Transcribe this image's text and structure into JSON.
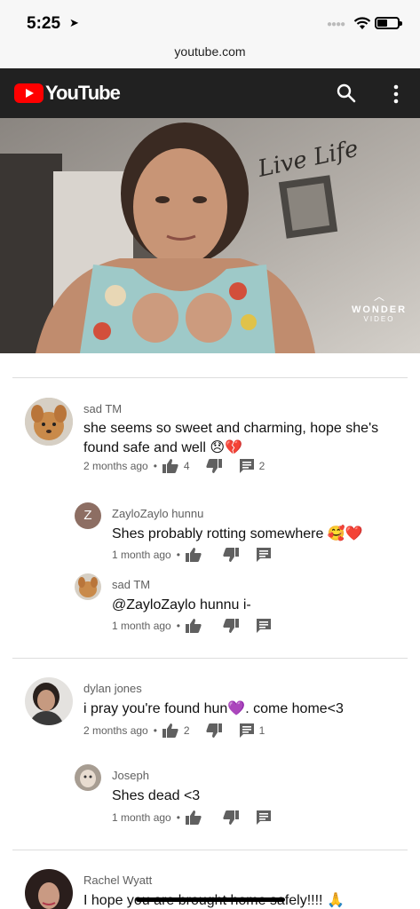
{
  "status": {
    "time": "5:25",
    "location_icon": "location-arrow-icon"
  },
  "browser": {
    "url": "youtube.com"
  },
  "header": {
    "logo_text": "YouTube"
  },
  "video": {
    "wall_text": "Live Life",
    "watermark_line1": "WONDER",
    "watermark_line2": "VIDEO"
  },
  "comments": [
    {
      "author": "sad TM",
      "text": "she seems so sweet and charming, hope she's found safe and well 😞💔",
      "age": "2 months ago",
      "likes": "4",
      "replies": "2",
      "replies_list": [
        {
          "author": "ZayloZaylo hunnu",
          "avatar_letter": "Z",
          "text": "Shes probably rotting somewhere 🥰❤️",
          "age": "1 month ago"
        },
        {
          "author": "sad TM",
          "text": "@ZayloZaylo hunnu i-",
          "age": "1 month ago"
        }
      ]
    },
    {
      "author": "dylan jones",
      "text": "i pray you're found hun💜. come home<3",
      "age": "2 months ago",
      "likes": "2",
      "replies": "1",
      "replies_list": [
        {
          "author": "Joseph",
          "text": "Shes dead <3",
          "age": "1 month ago"
        }
      ]
    },
    {
      "author": "Rachel Wyatt",
      "text": "I hope you are brought home safely!!!! 🙏"
    }
  ],
  "colors": {
    "header_bg": "#212121",
    "brand_red": "#ff0000",
    "meta_gray": "#606060"
  }
}
